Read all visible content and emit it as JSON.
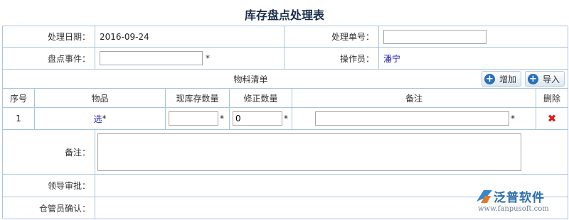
{
  "title": "库存盘点处理表",
  "header": {
    "date_label": "处理日期：",
    "date_value": "2016-09-24",
    "number_label": "处理单号：",
    "number_value": "",
    "event_label": "盘点事件：",
    "event_value": "",
    "required_mark": "*",
    "operator_label": "操作员：",
    "operator_value": "潘宁"
  },
  "materials": {
    "section_label": "物料清单",
    "add_label": "增加",
    "import_label": "导入",
    "columns": [
      "序号",
      "物品",
      "现库存数量",
      "修正数量",
      "备注",
      "删除"
    ],
    "rows": [
      {
        "index": "1",
        "item": "选",
        "current_qty": "",
        "corrected_qty": "0",
        "remark": ""
      }
    ]
  },
  "footer": {
    "remark_label": "备注：",
    "remark_value": "",
    "approval_label": "领导审批：",
    "keeper_label": "仓管员确认："
  },
  "brand": {
    "name": "泛普软件",
    "url": "www.fanpusoft.com"
  },
  "colors": {
    "border": "#a8c4df",
    "link": "#1a1aa6",
    "delete": "#d81b1b",
    "title": "#1b2e4a"
  }
}
